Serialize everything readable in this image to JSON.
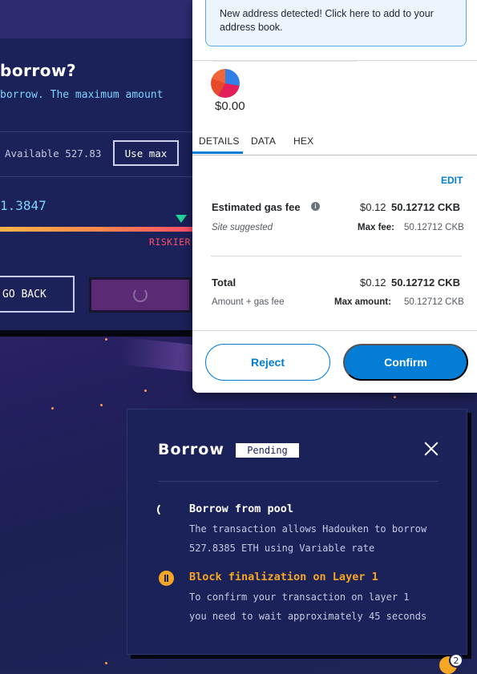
{
  "dapp": {
    "heading": "borrow?",
    "subtext": "borrow. The maximum amount",
    "available": "Available 527.83",
    "use_max": "Use max",
    "amount_value": "1.3847",
    "risk_label": "RISKIER",
    "go_back": "GO BACK"
  },
  "wallet": {
    "alert": "New address detected! Click here to add to your address book.",
    "balance": "$0.00",
    "tabs": [
      "DETAILS",
      "DATA",
      "HEX"
    ],
    "edit": "EDIT",
    "gas_label": "Estimated gas fee",
    "gas_usd": "$0.12",
    "gas_ckb": "50.12712 CKB",
    "site_suggested": "Site suggested",
    "max_fee_label": "Max fee:",
    "max_fee_value": "50.12712 CKB",
    "total_label": "Total",
    "total_usd": "$0.12",
    "total_ckb": "50.12712 CKB",
    "amount_gas_label": "Amount + gas fee",
    "max_amount_label": "Max amount:",
    "max_amount_value": "50.12712 CKB",
    "reject": "Reject",
    "confirm": "Confirm"
  },
  "modal": {
    "title": "Borrow",
    "status": "Pending",
    "steps": [
      {
        "title": "Borrow from pool",
        "desc_line1": "The transaction allows Hadouken to borrow",
        "desc_line2": "527.8385 ETH using Variable rate",
        "state": "in-progress"
      },
      {
        "title": "Block finalization on Layer 1",
        "desc_line1": "To confirm your transaction on layer 1",
        "desc_line2": "you need to wait approximately 45 seconds",
        "state": "paused"
      }
    ]
  },
  "notification_count": "2",
  "colors": {
    "wallet_primary": "#037dd6",
    "pending_warning": "#f5a623",
    "risk": "#ff4d6a",
    "accent_cyan": "#7fd4ff"
  }
}
